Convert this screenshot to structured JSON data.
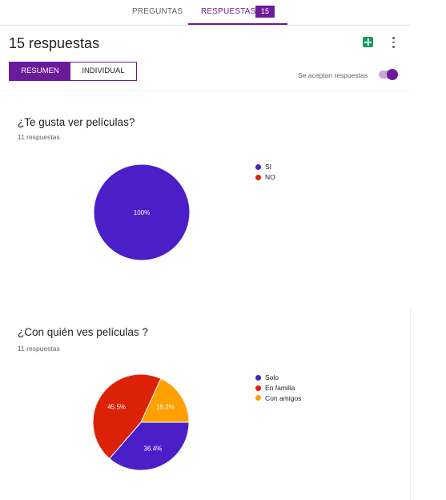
{
  "tabs": {
    "preguntas": "PREGUNTAS",
    "respuestas": "RESPUESTAS",
    "respuestas_count": "15"
  },
  "header": {
    "title": "15 respuestas",
    "sheets_icon": "sheets-icon",
    "more_icon": "more-vert-icon"
  },
  "view_toggle": {
    "resumen": "RESUMEN",
    "individual": "INDIVIDUAL",
    "selected": "RESUMEN"
  },
  "accepting": {
    "label": "Se aceptan respuestas",
    "on": true
  },
  "colors": {
    "accent": "#6a1b9a",
    "blue": "#4a1fc8",
    "red": "#dc2206",
    "orange": "#ffa000"
  },
  "questions": [
    {
      "title": "¿Te gusta ver películas?",
      "count": "11 respuestas"
    },
    {
      "title": "¿Con quién ves películas ?",
      "count": "11 respuestas"
    }
  ],
  "chart_data": [
    {
      "type": "pie",
      "categories": [
        "SI",
        "NO"
      ],
      "values": [
        100,
        0
      ],
      "data_labels": [
        "100%",
        ""
      ],
      "colors": [
        "#4a1fc8",
        "#dc2206"
      ],
      "legend": "right"
    },
    {
      "type": "pie",
      "categories": [
        "Solo",
        "En familia",
        "Con amigos"
      ],
      "values": [
        36.4,
        45.5,
        18.2
      ],
      "data_labels": [
        "36.4%",
        "45.5%",
        "18.2%"
      ],
      "colors": [
        "#4a1fc8",
        "#dc2206",
        "#ffa000"
      ],
      "legend": "right"
    }
  ]
}
